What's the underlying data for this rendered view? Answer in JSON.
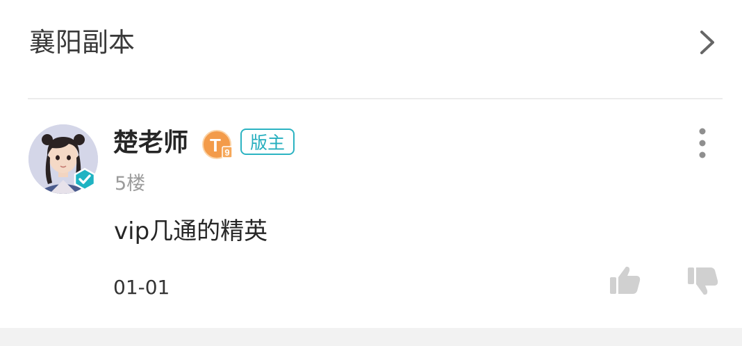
{
  "header": {
    "title": "襄阳副本",
    "chevron_icon": "chevron-right-icon"
  },
  "post": {
    "username": "楚老师",
    "level_badge": {
      "letter": "T",
      "number": "9",
      "color": "#f39b4a"
    },
    "role_badge": "版主",
    "floor": "5楼",
    "content": "vip几通的精英",
    "date": "01-01",
    "verified_icon": "verified-check-icon",
    "more_icon": "more-vertical-icon",
    "like_icon": "thumbs-up-icon",
    "dislike_icon": "thumbs-down-icon"
  },
  "colors": {
    "accent": "#2bb3c2",
    "icon_gray": "#d0d0d0",
    "text_dark": "#262626",
    "text_muted": "#9b9b9b"
  }
}
